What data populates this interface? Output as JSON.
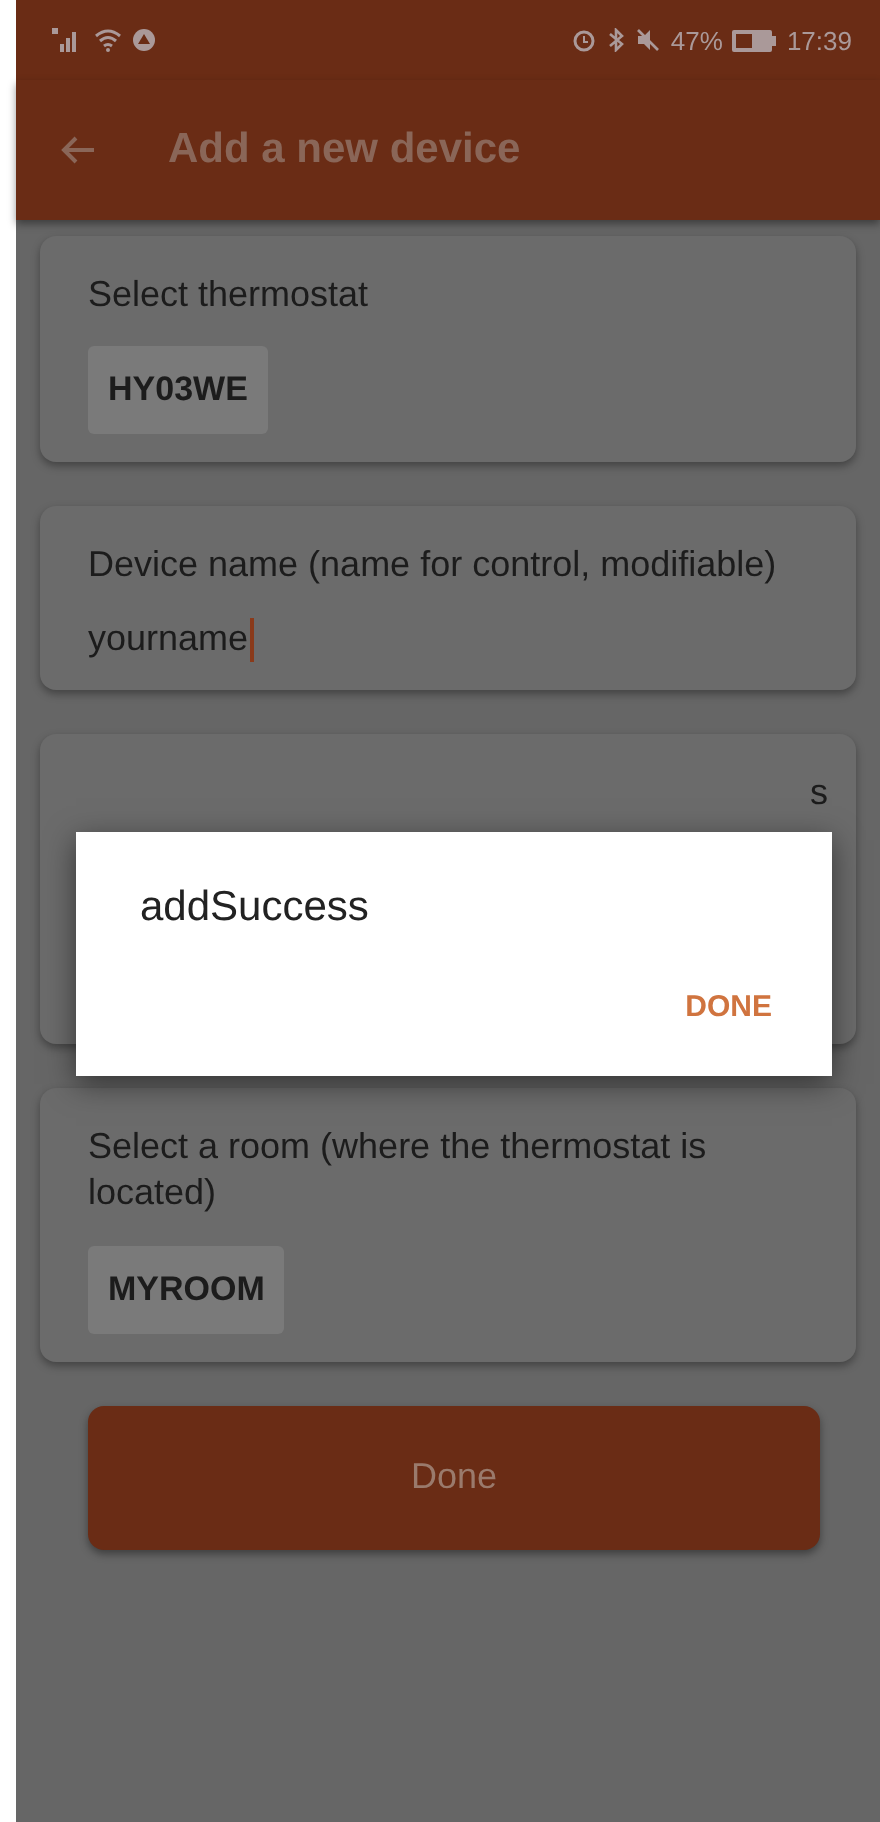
{
  "status_bar": {
    "battery_percent": "47%",
    "time": "17:39"
  },
  "app_bar": {
    "title": "Add a new device"
  },
  "cards": [
    {
      "kind": "chip",
      "label": "Select thermostat",
      "value": "HY03WE"
    },
    {
      "kind": "input",
      "label": "Device name (name for control, modifiable)",
      "value": "yourname"
    },
    {
      "kind": "hidden",
      "label": "s"
    },
    {
      "kind": "chip",
      "label": "Select a room (where the thermostat is located)",
      "value": "MYROOM"
    }
  ],
  "done_button": {
    "label": "Done"
  },
  "dialog": {
    "message": "addSuccess",
    "action": "DONE"
  }
}
